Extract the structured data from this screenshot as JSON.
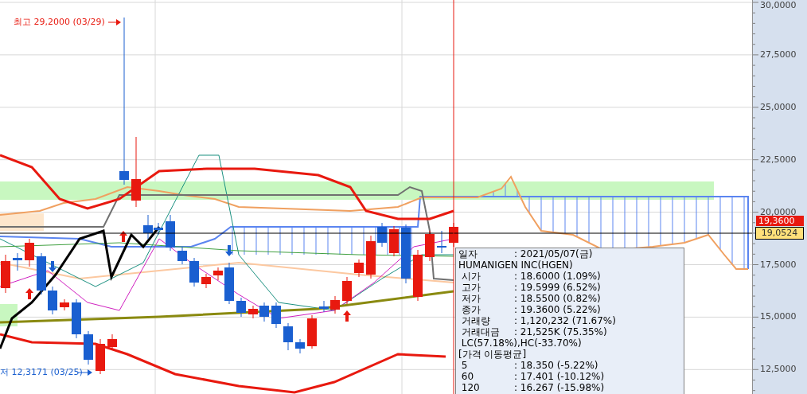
{
  "chart": {
    "high_label": "최고 29,2000 (03/29)",
    "low_label": "저 12,3171 (03/25)"
  },
  "y_axis": {
    "ticks": [
      "30,0000",
      "27,5000",
      "25,0000",
      "22,5000",
      "20,0000",
      "17,5000",
      "15,0000",
      "12,5000"
    ],
    "last_price": "19,3600",
    "marker_price": "19,0524"
  },
  "tooltip": {
    "rows": [
      {
        "kind": "field",
        "label": "일자",
        "value": ": 2021/05/07(금)"
      },
      {
        "kind": "heading",
        "label": "HUMANIGEN INC(HGEN)"
      },
      {
        "kind": "field",
        "label": " 시가",
        "value": ": 18.6000 (1.09%)"
      },
      {
        "kind": "field",
        "label": " 고가",
        "value": ": 19.5999 (6.52%)"
      },
      {
        "kind": "field",
        "label": " 저가",
        "value": ": 18.5500 (0.82%)"
      },
      {
        "kind": "field",
        "label": " 종가",
        "value": ": 19.3600 (5.22%)"
      },
      {
        "kind": "field",
        "label": " 거래량",
        "value": ": 1,120,232 (71.67%)"
      },
      {
        "kind": "field",
        "label": " 거래대금",
        "value": ": 21,525K (75.35%)"
      },
      {
        "kind": "heading",
        "label": " LC(57.18%),HC(-33.70%)"
      },
      {
        "kind": "heading",
        "label": "[가격 이동평균]"
      },
      {
        "kind": "field",
        "label": " 5",
        "value": ": 18.350 (-5.22%)"
      },
      {
        "kind": "field",
        "label": " 60",
        "value": ": 17.401 (-10.12%)"
      },
      {
        "kind": "field",
        "label": " 120",
        "value": ": 16.267 (-15.98%)"
      }
    ]
  }
}
